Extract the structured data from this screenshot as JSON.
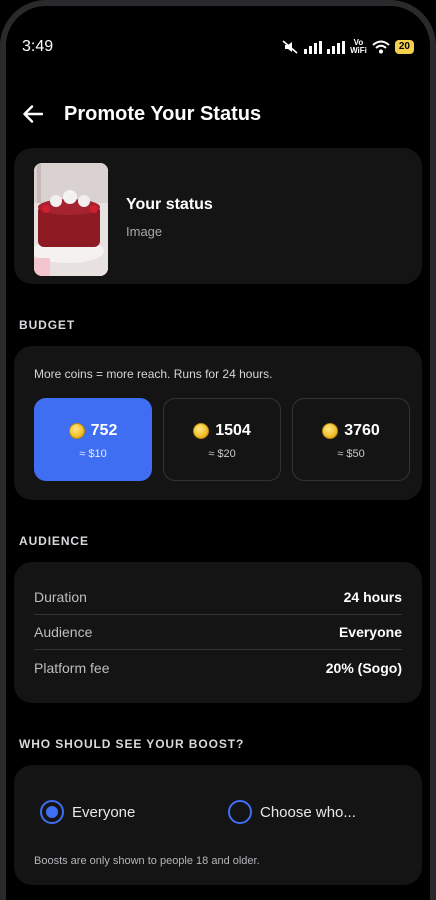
{
  "status_bar": {
    "time": "3:49",
    "vowifi_top": "Vo",
    "vowifi_bottom": "WiFi",
    "battery": "20"
  },
  "header": {
    "back_icon": "arrow-left-icon",
    "title": "Promote Your Status"
  },
  "status_card": {
    "title": "Your status",
    "subtitle": "Image"
  },
  "budget": {
    "section_label": "BUDGET",
    "note": "More coins = more reach. Runs for 24 hours.",
    "options": [
      {
        "coins": "752",
        "usd": "≈ $10",
        "selected": true
      },
      {
        "coins": "1504",
        "usd": "≈ $20",
        "selected": false
      },
      {
        "coins": "3760",
        "usd": "≈ $50",
        "selected": false
      }
    ]
  },
  "audience": {
    "section_label": "AUDIENCE",
    "rows": [
      {
        "label": "Duration",
        "value": "24 hours"
      },
      {
        "label": "Audience",
        "value": "Everyone"
      },
      {
        "label": "Platform fee",
        "value": "20% (Sogo)"
      }
    ]
  },
  "who": {
    "section_label": "WHO SHOULD SEE YOUR BOOST?",
    "options": [
      {
        "label": "Everyone",
        "selected": true
      },
      {
        "label": "Choose who...",
        "selected": false
      }
    ],
    "note": "Boosts are only shown to people 18 and older."
  },
  "colors": {
    "accent": "#3f6ef3",
    "card": "#141414",
    "background": "#000000"
  }
}
